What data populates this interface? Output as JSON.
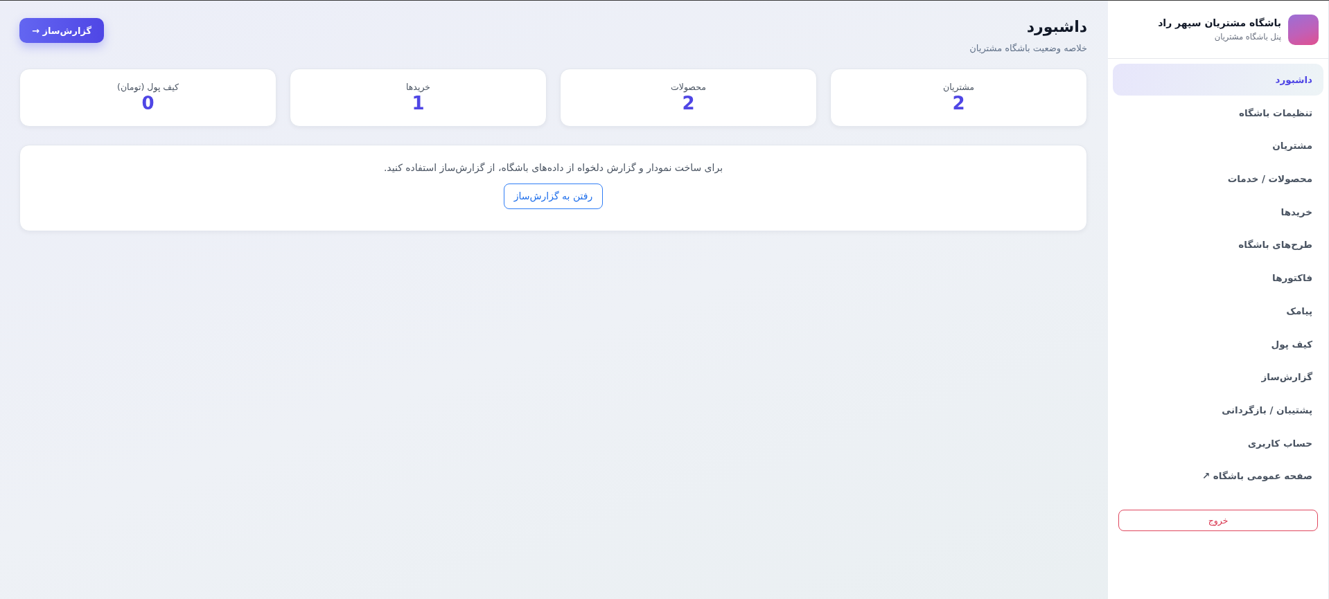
{
  "sidebar": {
    "brand": {
      "title": "باشگاه مشتریان سپهر راد",
      "subtitle": "پنل باشگاه مشتریان"
    },
    "items": [
      {
        "label": "داشبورد",
        "selected": true
      },
      {
        "label": "تنظیمات باشگاه",
        "selected": false
      },
      {
        "label": "مشتریان",
        "selected": false
      },
      {
        "label": "محصولات / خدمات",
        "selected": false
      },
      {
        "label": "خریدها",
        "selected": false
      },
      {
        "label": "طرح‌های باشگاه",
        "selected": false
      },
      {
        "label": "فاکتورها",
        "selected": false
      },
      {
        "label": "پیامک",
        "selected": false
      },
      {
        "label": "کیف پول",
        "selected": false
      },
      {
        "label": "گزارش‌ساز",
        "selected": false
      },
      {
        "label": "پشتیبان / بازگردانی",
        "selected": false
      },
      {
        "label": "حساب کاربری",
        "selected": false
      },
      {
        "label": "صفحه عمومی باشگاه ↗",
        "selected": false
      }
    ],
    "logout": "خروج"
  },
  "header": {
    "title": "داشبورد",
    "subtitle": "خلاصه وضعیت باشگاه مشتریان",
    "action": "گزارش‌ساز →"
  },
  "stats": [
    {
      "label": "مشتریان",
      "value": "2"
    },
    {
      "label": "محصولات",
      "value": "2"
    },
    {
      "label": "خریدها",
      "value": "1"
    },
    {
      "label": "کیف پول (تومان)",
      "value": "0"
    }
  ],
  "notice": {
    "text": "برای ساخت نمودار و گزارش دلخواه از داده‌های باشگاه، از گزارش‌ساز استفاده کنید.",
    "button": "رفتن به گزارش‌ساز"
  }
}
